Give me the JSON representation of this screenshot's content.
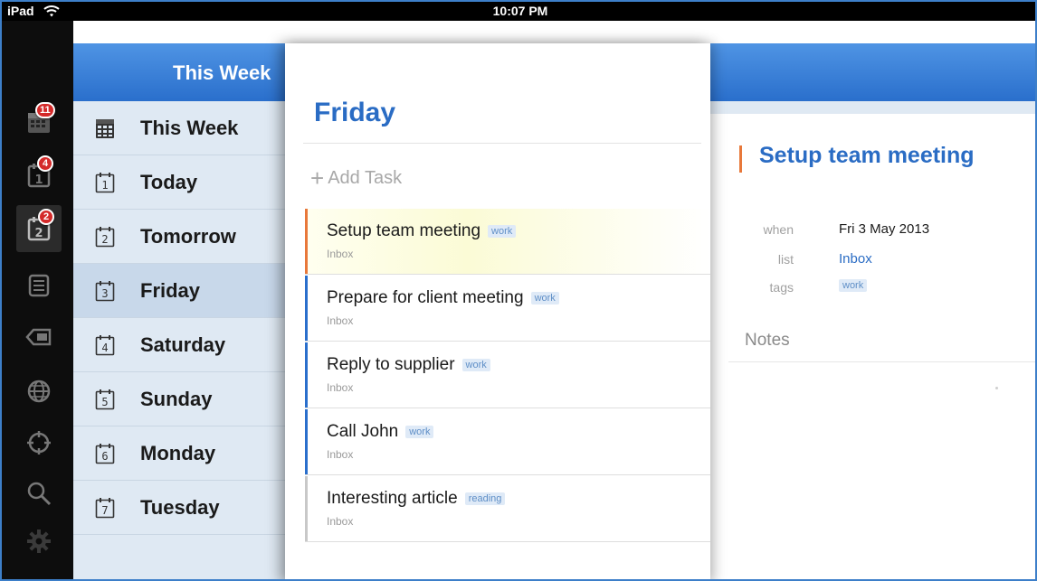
{
  "status_bar": {
    "device": "iPad",
    "time": "10:07 PM"
  },
  "icon_strip": {
    "buttons": [
      {
        "icon": "this-week-calendar-icon",
        "badge": "11"
      },
      {
        "icon": "today-calendar-icon",
        "badge": "4"
      },
      {
        "icon": "tomorrow-calendar-icon",
        "badge": "2"
      },
      {
        "icon": "list-icon",
        "badge": ""
      },
      {
        "icon": "tag-icon",
        "badge": ""
      },
      {
        "icon": "globe-icon",
        "badge": ""
      },
      {
        "icon": "target-icon",
        "badge": ""
      },
      {
        "icon": "search-icon",
        "badge": ""
      },
      {
        "icon": "gear-icon",
        "badge": ""
      }
    ]
  },
  "sidebar": {
    "header_title": "This Week",
    "items": [
      {
        "label": "This Week",
        "icon_text": ""
      },
      {
        "label": "Today",
        "icon_text": "1"
      },
      {
        "label": "Tomorrow",
        "icon_text": "2"
      },
      {
        "label": "Friday",
        "icon_text": "3"
      },
      {
        "label": "Saturday",
        "icon_text": "4"
      },
      {
        "label": "Sunday",
        "icon_text": "5"
      },
      {
        "label": "Monday",
        "icon_text": "6"
      },
      {
        "label": "Tuesday",
        "icon_text": "7"
      }
    ],
    "selected": "Friday"
  },
  "task_list": {
    "title": "Friday",
    "add_task_label": "Add Task",
    "add_task_plus": "+",
    "tasks": [
      {
        "title": "Setup team meeting",
        "tag": "work",
        "list": "Inbox",
        "bar_color": "#e8783a"
      },
      {
        "title": "Prepare for client meeting",
        "tag": "work",
        "list": "Inbox",
        "bar_color": "#2a6fcc"
      },
      {
        "title": "Reply to supplier",
        "tag": "work",
        "list": "Inbox",
        "bar_color": "#2a6fcc"
      },
      {
        "title": "Call John",
        "tag": "work",
        "list": "Inbox",
        "bar_color": "#2a6fcc"
      },
      {
        "title": "Interesting article",
        "tag": "reading",
        "list": "Inbox",
        "bar_color": "#c8c8c8"
      }
    ]
  },
  "detail": {
    "title": "Setup team meeting",
    "when_label": "when",
    "when_value": "Fri 3 May 2013",
    "list_label": "list",
    "list_value": "Inbox",
    "tags_label": "tags",
    "tags_value": "work",
    "notes_label": "Notes"
  },
  "colors": {
    "accent_blue": "#2a6cc4",
    "header_blue": "#3d85de",
    "selected_task": "#e8783a",
    "badge_red": "#d42a2a"
  }
}
